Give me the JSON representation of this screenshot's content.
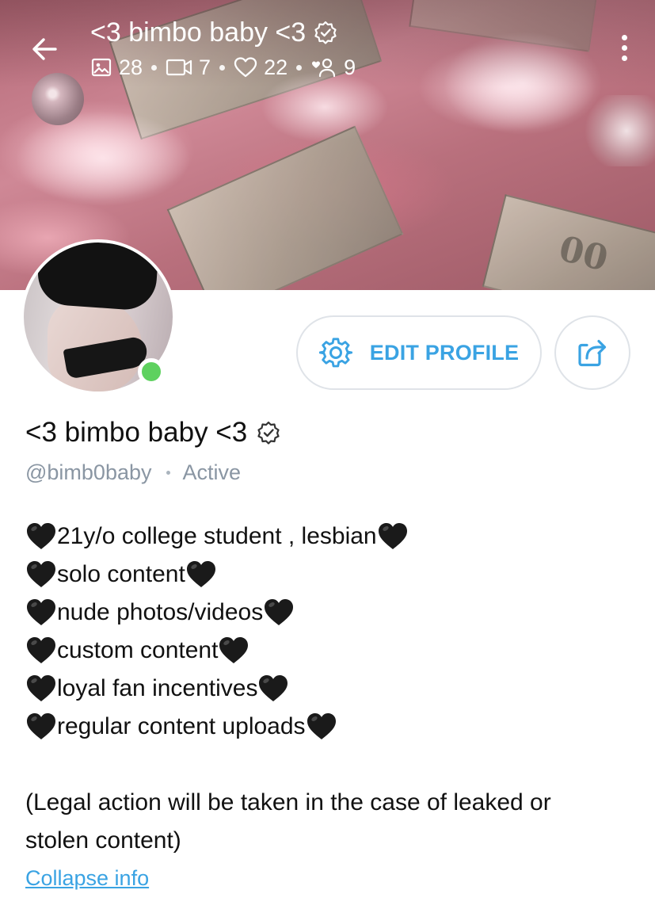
{
  "header": {
    "title": "<3 bimbo baby <3",
    "stats": {
      "photos": "28",
      "videos": "7",
      "likes": "22",
      "fans": "9"
    },
    "icons": {
      "back": "arrow-left-icon",
      "verified": "verified-badge-icon",
      "photos": "image-icon",
      "videos": "video-icon",
      "likes": "heart-outline-icon",
      "fans": "fans-icon",
      "menu": "more-vertical-icon"
    }
  },
  "actions": {
    "edit_profile_label": "EDIT PROFILE",
    "edit_icon": "gear-icon",
    "share_icon": "share-icon"
  },
  "profile": {
    "name": "<3 bimbo baby <3",
    "handle": "@bimb0baby",
    "status": "Active",
    "online": true
  },
  "bio": {
    "lines": [
      "21y/o college student , lesbian",
      "solo content",
      "nude photos/videos",
      "custom content",
      "loyal fan incentives",
      "regular content uploads"
    ],
    "emoji": "black-heart-icon",
    "legal": "(Legal action will be taken in the case of leaked or stolen content)"
  },
  "collapse_label": "Collapse info",
  "colors": {
    "accent": "#3aa3e3",
    "muted": "#8a96a3",
    "online": "#5ed15f",
    "border": "#dfe3e8"
  }
}
